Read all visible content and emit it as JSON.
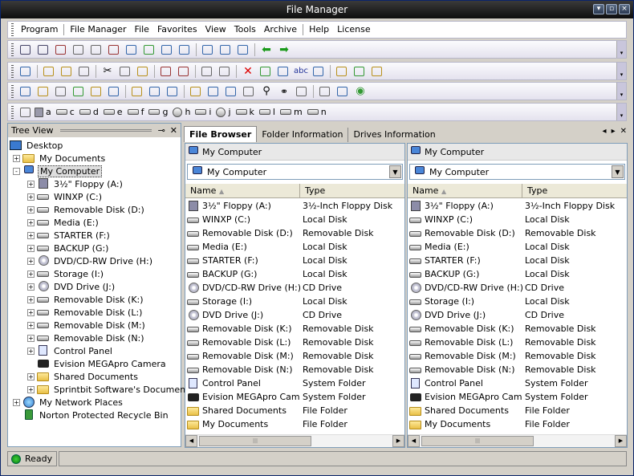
{
  "window": {
    "title": "File Manager"
  },
  "menu": [
    "Program",
    "File Manager",
    "File",
    "Favorites",
    "View",
    "Tools",
    "Archive",
    "Help",
    "License"
  ],
  "drive_bar": [
    "a",
    "c",
    "d",
    "e",
    "f",
    "g",
    "h",
    "i",
    "j",
    "k",
    "l",
    "m",
    "n"
  ],
  "tree": {
    "title": "Tree View",
    "nodes": [
      {
        "label": "Desktop",
        "icon": "desktop-icon",
        "indent": 0,
        "pm": ""
      },
      {
        "label": "My Documents",
        "icon": "folder-icon",
        "indent": 1,
        "pm": "+"
      },
      {
        "label": "My Computer",
        "icon": "computer-icon",
        "indent": 1,
        "pm": "-",
        "selected": true
      },
      {
        "label": "3½\" Floppy (A:)",
        "icon": "floppy-icon",
        "indent": 2,
        "pm": "+"
      },
      {
        "label": "WINXP (C:)",
        "icon": "drive-icon",
        "indent": 2,
        "pm": "+"
      },
      {
        "label": "Removable Disk (D:)",
        "icon": "drive-icon",
        "indent": 2,
        "pm": "+"
      },
      {
        "label": "Media (E:)",
        "icon": "drive-icon",
        "indent": 2,
        "pm": "+"
      },
      {
        "label": "STARTER (F:)",
        "icon": "drive-icon",
        "indent": 2,
        "pm": "+"
      },
      {
        "label": "BACKUP (G:)",
        "icon": "drive-icon",
        "indent": 2,
        "pm": "+"
      },
      {
        "label": "DVD/CD-RW Drive (H:)",
        "icon": "cd-icon",
        "indent": 2,
        "pm": "+"
      },
      {
        "label": "Storage (I:)",
        "icon": "drive-icon",
        "indent": 2,
        "pm": "+"
      },
      {
        "label": "DVD Drive (J:)",
        "icon": "cd-icon",
        "indent": 2,
        "pm": "+"
      },
      {
        "label": "Removable Disk (K:)",
        "icon": "drive-icon",
        "indent": 2,
        "pm": "+"
      },
      {
        "label": "Removable Disk (L:)",
        "icon": "drive-icon",
        "indent": 2,
        "pm": "+"
      },
      {
        "label": "Removable Disk (M:)",
        "icon": "drive-icon",
        "indent": 2,
        "pm": "+"
      },
      {
        "label": "Removable Disk (N:)",
        "icon": "drive-icon",
        "indent": 2,
        "pm": "+"
      },
      {
        "label": "Control Panel",
        "icon": "control-panel-icon",
        "indent": 2,
        "pm": "+"
      },
      {
        "label": "Evision MEGApro Camera",
        "icon": "camera-icon",
        "indent": 2,
        "pm": ""
      },
      {
        "label": "Shared Documents",
        "icon": "folder-icon",
        "indent": 2,
        "pm": "+"
      },
      {
        "label": "Sprintbit Software's Documents",
        "icon": "folder-icon",
        "indent": 2,
        "pm": "+"
      },
      {
        "label": "My Network Places",
        "icon": "network-icon",
        "indent": 1,
        "pm": "+"
      },
      {
        "label": "Norton Protected Recycle Bin",
        "icon": "recycle-bin-icon",
        "indent": 1,
        "pm": ""
      }
    ]
  },
  "tabs": [
    "File Browser",
    "Folder Information",
    "Drives Information"
  ],
  "panes": [
    {
      "path": "My Computer",
      "combo": "My Computer",
      "columns": [
        "Name",
        "Type"
      ],
      "rows": [
        {
          "name": "3½\" Floppy (A:)",
          "type": "3½-Inch Floppy Disk",
          "icon": "floppy-icon"
        },
        {
          "name": "WINXP (C:)",
          "type": "Local Disk",
          "icon": "drive-icon"
        },
        {
          "name": "Removable Disk (D:)",
          "type": "Removable Disk",
          "icon": "drive-icon"
        },
        {
          "name": "Media (E:)",
          "type": "Local Disk",
          "icon": "drive-icon"
        },
        {
          "name": "STARTER (F:)",
          "type": "Local Disk",
          "icon": "drive-icon"
        },
        {
          "name": "BACKUP (G:)",
          "type": "Local Disk",
          "icon": "drive-icon"
        },
        {
          "name": "DVD/CD-RW Drive (H:)",
          "type": "CD Drive",
          "icon": "cd-icon"
        },
        {
          "name": "Storage (I:)",
          "type": "Local Disk",
          "icon": "drive-icon"
        },
        {
          "name": "DVD Drive (J:)",
          "type": "CD Drive",
          "icon": "cd-icon"
        },
        {
          "name": "Removable Disk (K:)",
          "type": "Removable Disk",
          "icon": "drive-icon"
        },
        {
          "name": "Removable Disk (L:)",
          "type": "Removable Disk",
          "icon": "drive-icon"
        },
        {
          "name": "Removable Disk (M:)",
          "type": "Removable Disk",
          "icon": "drive-icon"
        },
        {
          "name": "Removable Disk (N:)",
          "type": "Removable Disk",
          "icon": "drive-icon"
        },
        {
          "name": "Control Panel",
          "type": "System Folder",
          "icon": "control-panel-icon"
        },
        {
          "name": "Evision MEGApro Cam...",
          "type": "System Folder",
          "icon": "camera-icon"
        },
        {
          "name": "Shared Documents",
          "type": "File Folder",
          "icon": "folder-icon"
        },
        {
          "name": "My Documents",
          "type": "File Folder",
          "icon": "folder-icon"
        }
      ]
    },
    {
      "path": "My Computer",
      "combo": "My Computer",
      "columns": [
        "Name",
        "Type"
      ],
      "rows": [
        {
          "name": "3½\" Floppy (A:)",
          "type": "3½-Inch Floppy Disk",
          "icon": "floppy-icon"
        },
        {
          "name": "WINXP (C:)",
          "type": "Local Disk",
          "icon": "drive-icon"
        },
        {
          "name": "Removable Disk (D:)",
          "type": "Removable Disk",
          "icon": "drive-icon"
        },
        {
          "name": "Media (E:)",
          "type": "Local Disk",
          "icon": "drive-icon"
        },
        {
          "name": "STARTER (F:)",
          "type": "Local Disk",
          "icon": "drive-icon"
        },
        {
          "name": "BACKUP (G:)",
          "type": "Local Disk",
          "icon": "drive-icon"
        },
        {
          "name": "DVD/CD-RW Drive (H:)",
          "type": "CD Drive",
          "icon": "cd-icon"
        },
        {
          "name": "Storage (I:)",
          "type": "Local Disk",
          "icon": "drive-icon"
        },
        {
          "name": "DVD Drive (J:)",
          "type": "CD Drive",
          "icon": "cd-icon"
        },
        {
          "name": "Removable Disk (K:)",
          "type": "Removable Disk",
          "icon": "drive-icon"
        },
        {
          "name": "Removable Disk (L:)",
          "type": "Removable Disk",
          "icon": "drive-icon"
        },
        {
          "name": "Removable Disk (M:)",
          "type": "Removable Disk",
          "icon": "drive-icon"
        },
        {
          "name": "Removable Disk (N:)",
          "type": "Removable Disk",
          "icon": "drive-icon"
        },
        {
          "name": "Control Panel",
          "type": "System Folder",
          "icon": "control-panel-icon"
        },
        {
          "name": "Evision MEGApro Cam...",
          "type": "System Folder",
          "icon": "camera-icon"
        },
        {
          "name": "Shared Documents",
          "type": "File Folder",
          "icon": "folder-icon"
        },
        {
          "name": "My Documents",
          "type": "File Folder",
          "icon": "folder-icon"
        }
      ]
    }
  ],
  "status": {
    "text": "Ready"
  }
}
